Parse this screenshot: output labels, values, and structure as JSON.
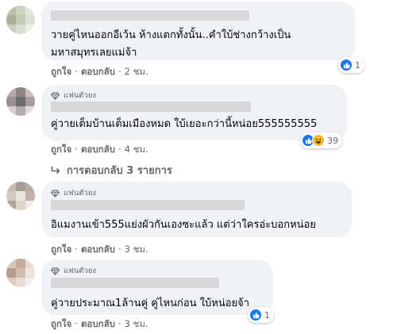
{
  "comments": [
    {
      "text": "วายคู่ไหนออกอีเว้น ห้างแตกทั้งนั้น..คำใบ้ช่างกว้างเป็น\nมหาสมุทรเลยแม่จ้า",
      "like": "ถูกใจ",
      "reply": "ตอบกลับ",
      "time": "2 ชม.",
      "reaction_count": "1"
    },
    {
      "badge": "แฟนตัวยง",
      "text": "คู่วายเต็มบ้านเต็มเมืองหมด ใบ้เยอะกว่านี้หน่อย555555555",
      "like": "ถูกใจ",
      "reply": "ตอบกลับ",
      "time": "4 ชม.",
      "reaction_count": "39",
      "replies_label": "การตอบกลับ 3 รายการ"
    },
    {
      "badge": "แฟนตัวยง",
      "text": "อิแมงานเข้า555แย่งผัวกันเองซะแล้ว แต่ว่าใครอ่ะบอกหน่อย",
      "like": "ถูกใจ",
      "reply": "ตอบกลับ",
      "time": "3 ชม."
    },
    {
      "badge": "แฟนตัวยง",
      "text": "คู่วายประมาณ1ล้านคู่ คู่ไหนก่อน ใบ้หน่อยจ้า",
      "like": "ถูกใจ",
      "reply": "ตอบกลับ",
      "time": "3 ชม.",
      "reaction_count": "1"
    }
  ],
  "colors": {
    "like_blue": "#1877f2",
    "haha_yellow": "#f7b928",
    "bubble_bg": "#f0f2f5",
    "meta_gray": "#65676b"
  },
  "icons": [
    "like-icon",
    "haha-icon",
    "diamond-icon",
    "reply-arrow-icon"
  ]
}
